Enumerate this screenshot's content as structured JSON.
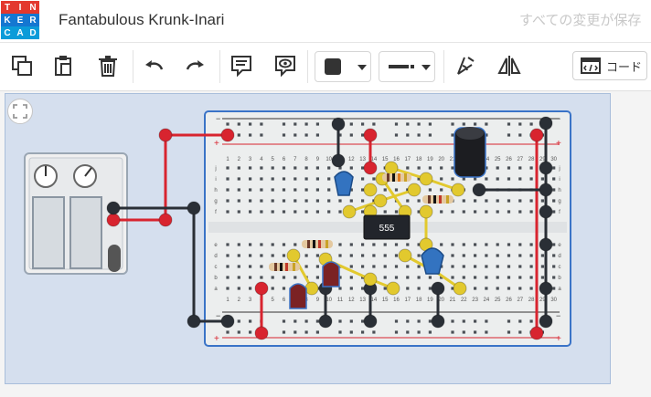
{
  "app": {
    "logo_letters": [
      "T",
      "I",
      "N",
      "K",
      "E",
      "R",
      "C",
      "A",
      "D"
    ],
    "logo_colors": [
      "#e3382e",
      "#e3382e",
      "#e3382e",
      "#1477d1",
      "#1477d1",
      "#1477d1",
      "#0b9bd9",
      "#0b9bd9",
      "#0b9bd9"
    ],
    "project_title": "Fantabulous Krunk-Inari",
    "save_status": "すべての変更が保存"
  },
  "toolbar": {
    "tools": [
      "copy-icon",
      "paste-icon",
      "delete-icon",
      "undo-icon",
      "redo-icon",
      "note-icon",
      "view-icon"
    ],
    "fill_color": "#333333",
    "line_style": "solid",
    "right_tools": [
      "rotate-icon",
      "flip-icon"
    ],
    "code_label": "コード"
  },
  "circuit": {
    "chip_label": "555",
    "wire_colors": {
      "power": "#d8242f",
      "ground": "#2a2f36",
      "signal": "#e2c92e"
    },
    "breadboard_columns": [
      "1",
      "2",
      "3",
      "4",
      "5",
      "6",
      "7",
      "8",
      "9",
      "10",
      "11",
      "12",
      "13",
      "14",
      "15",
      "16",
      "17",
      "18",
      "19",
      "20",
      "21",
      "22",
      "23",
      "24",
      "25",
      "26",
      "27",
      "28",
      "29",
      "30"
    ],
    "breadboard_rows_top": [
      "j",
      "i",
      "h",
      "g",
      "f"
    ],
    "breadboard_rows_bottom": [
      "e",
      "d",
      "c",
      "b",
      "a"
    ],
    "rail_signs": [
      "+",
      "-"
    ]
  },
  "overlay": {
    "fit_view_icon": "fit-view-icon"
  }
}
